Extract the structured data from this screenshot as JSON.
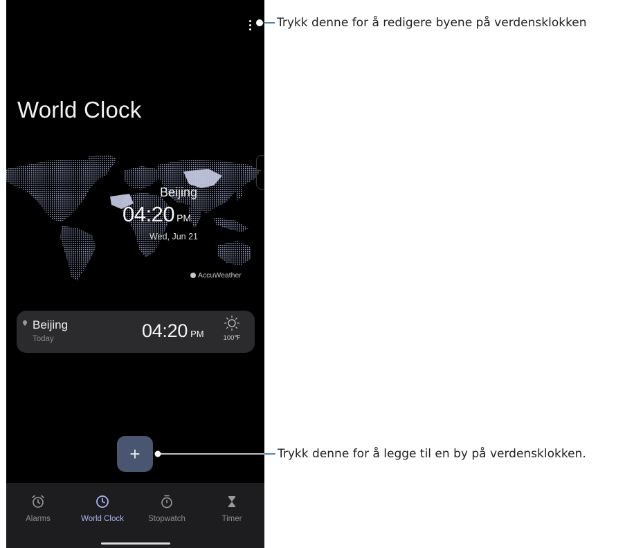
{
  "app": {
    "title": "World Clock"
  },
  "map_overlay": {
    "city": "Beijing",
    "time": "04:20",
    "ampm": "PM",
    "date": "Wed, Jun 21",
    "provider": "AccuWeather"
  },
  "city_list": [
    {
      "name": "Beijing",
      "day": "Today",
      "time": "04:20",
      "ampm": "PM",
      "weather_icon": "sun-icon",
      "temperature": "100℉"
    }
  ],
  "add_button": {
    "label": "+"
  },
  "bottom_nav": {
    "items": [
      {
        "label": "Alarms",
        "icon": "alarm-clock-icon",
        "active": false
      },
      {
        "label": "World Clock",
        "icon": "clock-icon",
        "active": true
      },
      {
        "label": "Stopwatch",
        "icon": "stopwatch-icon",
        "active": false
      },
      {
        "label": "Timer",
        "icon": "hourglass-icon",
        "active": false
      }
    ]
  },
  "callouts": {
    "menu": "Trykk denne for å redigere byene på verdensklokken",
    "add": "Trykk denne for å legge til en by på verdensklokken."
  },
  "colors": {
    "background": "#000000",
    "card": "#2b2b2d",
    "fab": "#4a5670",
    "nav_active": "#a9b6f0",
    "callout_line": "#1d5a8a"
  }
}
